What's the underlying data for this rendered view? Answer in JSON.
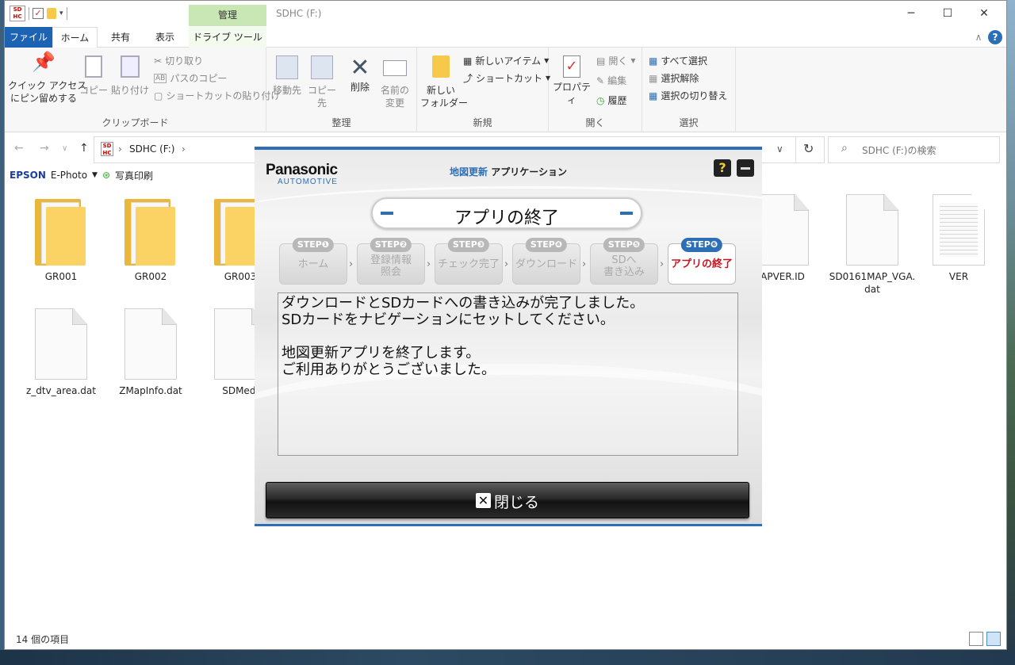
{
  "window": {
    "title": "SDHC (F:)",
    "manage_tab": "管理",
    "qat_drive_icon": "SD\nHC"
  },
  "tabs": {
    "file": "ファイル",
    "home": "ホーム",
    "share": "共有",
    "view": "表示",
    "drive_tools": "ドライブ ツール"
  },
  "ribbon": {
    "clipboard": {
      "pin": "クイック アクセス\nにピン留めする",
      "copy": "コピー",
      "paste": "貼り付け",
      "cut": "切り取り",
      "copy_path": "パスのコピー",
      "paste_shortcut": "ショートカットの貼り付け",
      "label": "クリップボード"
    },
    "organize": {
      "move_to": "移動先",
      "copy_to": "コピー先",
      "delete": "削除",
      "rename": "名前の\n変更",
      "label": "整理"
    },
    "new": {
      "new_folder": "新しい\nフォルダー",
      "new_item": "新しいアイテム",
      "easy_access": "ショートカット",
      "label": "新規"
    },
    "open": {
      "properties": "プロパティ",
      "open": "開く",
      "edit": "編集",
      "history": "履歴",
      "label": "開く"
    },
    "select": {
      "select_all": "すべて選択",
      "select_none": "選択解除",
      "invert": "選択の切り替え",
      "label": "選択"
    }
  },
  "address": {
    "path": "SDHC (F:)",
    "search_placeholder": "SDHC (F:)の検索"
  },
  "epson_bar": {
    "brand": "EPSON",
    "app": "E-Photo",
    "print": "写真印刷"
  },
  "files": [
    {
      "name": "GR001",
      "kind": "folder"
    },
    {
      "name": "GR002",
      "kind": "folder"
    },
    {
      "name": "GR003",
      "kind": "folder"
    },
    {
      "name": "APVER.ID",
      "kind": "file"
    },
    {
      "name": "SD0161MAP_VGA.dat",
      "kind": "file"
    },
    {
      "name": "VER",
      "kind": "text"
    },
    {
      "name": "z_dtv_area.dat",
      "kind": "file"
    },
    {
      "name": "ZMapInfo.dat",
      "kind": "file"
    },
    {
      "name": "SDMedi",
      "kind": "file"
    }
  ],
  "status": {
    "count": "14 個の項目"
  },
  "dialog": {
    "brand": "Panasonic",
    "sub": "AUTOMOTIVE",
    "title_blue": "地図更新",
    "title_rest": " アプリケーション",
    "help": "?",
    "heading": "アプリの終了",
    "steps": [
      {
        "badge": "STEP❶",
        "label": "ホーム"
      },
      {
        "badge": "STEP❷",
        "label": "登録情報\n照会"
      },
      {
        "badge": "STEP❸",
        "label": "チェック完了"
      },
      {
        "badge": "STEP❹",
        "label": "ダウンロード"
      },
      {
        "badge": "STEP❺",
        "label": "SDへ\n書き込み"
      },
      {
        "badge": "STEP❻",
        "label": "アプリの終了"
      }
    ],
    "message": "ダウンロードとSDカードへの書き込みが完了しました。\nSDカードをナビゲーションにセットしてください。\n\n地図更新アプリを終了します。\nご利用ありがとうございました。",
    "close_label": "閉じる"
  },
  "colors": {
    "accent": "#2d6fb5",
    "file_tab": "#1d63b3",
    "manage": "#c8e7b4",
    "active_step": "#c8141e"
  }
}
